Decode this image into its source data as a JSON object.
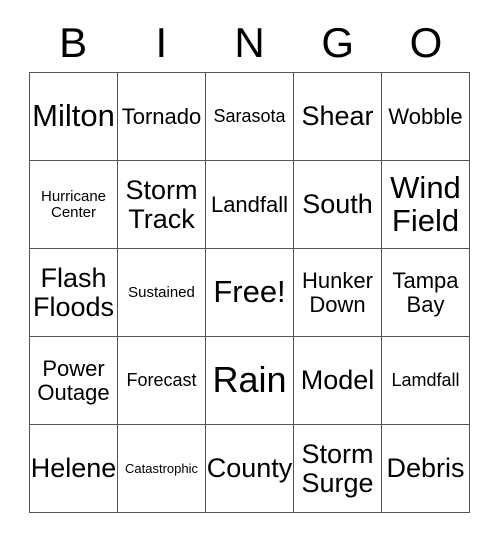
{
  "card": {
    "type": "bingo-card",
    "theme": "hurricane",
    "columns": 5,
    "rows": 5,
    "text_color": "#000000",
    "grid_line_color": "#555555",
    "background_color": "#ffffff"
  },
  "header": {
    "letters": [
      "B",
      "I",
      "N",
      "G",
      "O"
    ]
  },
  "grid": {
    "rows": [
      [
        {
          "label": "Milton",
          "size": "xl",
          "free": false
        },
        {
          "label": "Tornado",
          "size": "md",
          "free": false
        },
        {
          "label": "Sarasota",
          "size": "sm",
          "free": false
        },
        {
          "label": "Shear",
          "size": "lg",
          "free": false
        },
        {
          "label": "Wobble",
          "size": "md",
          "free": false
        }
      ],
      [
        {
          "label": "Hurricane\nCenter",
          "size": "xs",
          "free": false
        },
        {
          "label": "Storm\nTrack",
          "size": "lg",
          "free": false
        },
        {
          "label": "Landfall",
          "size": "md",
          "free": false
        },
        {
          "label": "South",
          "size": "lg",
          "free": false
        },
        {
          "label": "Wind\nField",
          "size": "xl",
          "free": false
        }
      ],
      [
        {
          "label": "Flash\nFloods",
          "size": "lg",
          "free": false
        },
        {
          "label": "Sustained",
          "size": "xs",
          "free": false
        },
        {
          "label": "Free!",
          "size": "xl",
          "free": true
        },
        {
          "label": "Hunker\nDown",
          "size": "md",
          "free": false
        },
        {
          "label": "Tampa\nBay",
          "size": "md",
          "free": false
        }
      ],
      [
        {
          "label": "Power\nOutage",
          "size": "md",
          "free": false
        },
        {
          "label": "Forecast",
          "size": "sm",
          "free": false
        },
        {
          "label": "Rain",
          "size": "xxl",
          "free": false
        },
        {
          "label": "Model",
          "size": "lg",
          "free": false
        },
        {
          "label": "Lamdfall",
          "size": "sm",
          "free": false
        }
      ],
      [
        {
          "label": "Helene",
          "size": "lg",
          "free": false
        },
        {
          "label": "Catastrophic",
          "size": "xxs",
          "free": false
        },
        {
          "label": "County",
          "size": "lg",
          "free": false
        },
        {
          "label": "Storm\nSurge",
          "size": "lg",
          "free": false
        },
        {
          "label": "Debris",
          "size": "lg",
          "free": false
        }
      ]
    ]
  }
}
